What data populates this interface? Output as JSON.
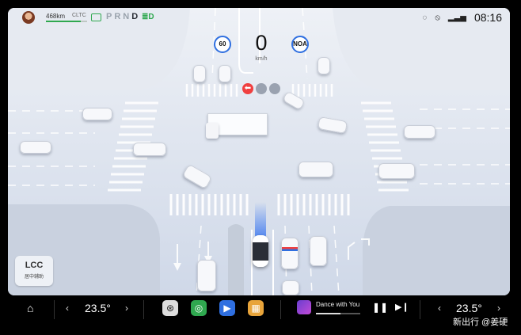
{
  "status": {
    "range": "468km",
    "range_fraction": 0.85,
    "range_standard": "CLTC",
    "gears": [
      "P",
      "R",
      "N",
      "D"
    ],
    "active_gear": "D",
    "time": "08:16",
    "icons": [
      "battery-icon",
      "headlight-icon",
      "message-icon",
      "phone-off-icon",
      "signal-icon"
    ]
  },
  "driving": {
    "speed": "0",
    "speed_unit": "km/h",
    "speed_limit": "60",
    "mode": "NOA",
    "traffic_light": "red-left-arrow"
  },
  "lcc": {
    "icon": "LCC",
    "label": "居中辅助"
  },
  "dock": {
    "left_temp": "23.5°",
    "right_temp": "23.5°",
    "song": "Dance with You",
    "song_progress": 0.55,
    "apps": [
      "steering-app-icon",
      "navigation-app-icon",
      "camera-app-icon",
      "apps-grid-icon"
    ],
    "watermark": "新出行 @姜硬"
  },
  "colors": {
    "accent_blue": "#2f6fe0",
    "green": "#2fa84f",
    "red": "#f04040",
    "road": "#dde3ee"
  }
}
